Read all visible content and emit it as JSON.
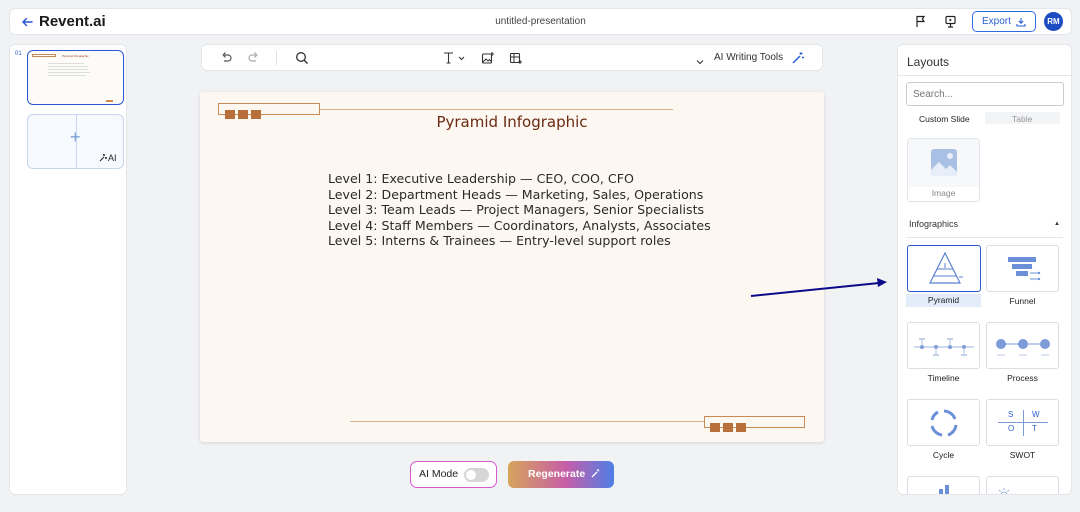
{
  "header": {
    "brand": "Revent.ai",
    "document_title": "untitled-presentation",
    "export_label": "Export",
    "avatar_initials": "RM"
  },
  "slide_panel": {
    "slide_number": "01",
    "thumb_title": "Pyramid Infographic",
    "add_slide_ai_label": "AI"
  },
  "editor_toolbar": {
    "ai_writing_tools_label": "AI Writing Tools"
  },
  "slide": {
    "title": "Pyramid Infographic",
    "lines": [
      "Level 1: Executive Leadership — CEO, COO, CFO",
      "Level 2: Department Heads — Marketing, Sales, Operations",
      "Level 3: Team Leads — Project Managers, Senior Specialists",
      "Level 4: Staff Members — Coordinators, Analysts, Associates",
      "Level 5: Interns & Trainees — Entry-level support roles"
    ]
  },
  "controls": {
    "ai_mode_label": "AI Mode",
    "ai_mode_on": false,
    "regenerate_label": "Regenerate"
  },
  "layouts_panel": {
    "heading": "Layouts",
    "search_placeholder": "Search...",
    "tabs": [
      "Custom Slide",
      "Table"
    ],
    "image_label": "Image",
    "section_title": "Infographics",
    "items": [
      "Pyramid",
      "Funnel",
      "Timeline",
      "Process",
      "Cycle",
      "SWOT"
    ],
    "selected": "Pyramid",
    "swot_letters": [
      "S",
      "W",
      "O",
      "T"
    ]
  },
  "colors": {
    "accent": "#2a5ed1",
    "slide_title": "#6a2a12",
    "decor": "#b8703a",
    "annotation_arrow": "#0a0a8a"
  }
}
